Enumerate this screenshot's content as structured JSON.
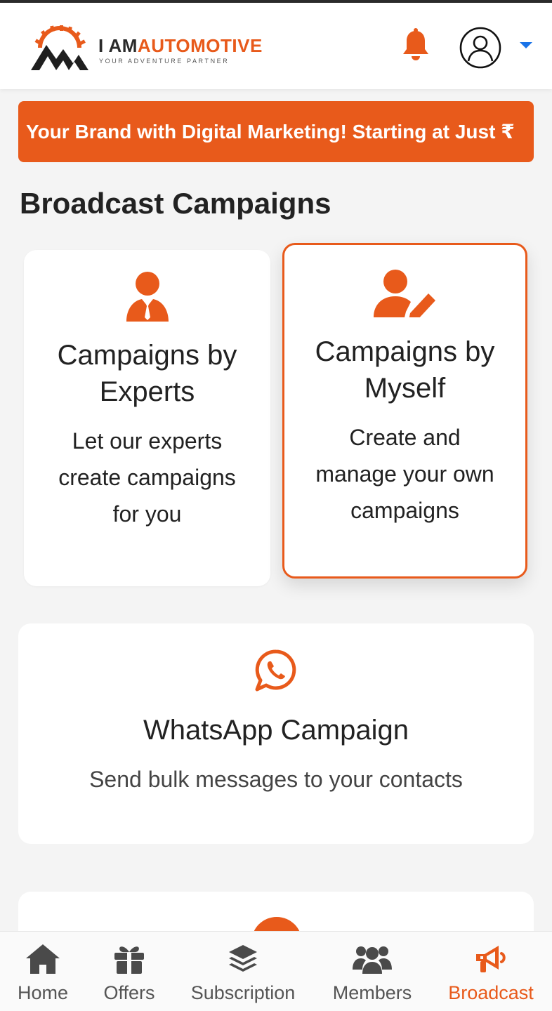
{
  "app": {
    "brand_part1": "I AM",
    "brand_part2": "AUTOMOTIVE",
    "tagline": "YOUR ADVENTURE PARTNER"
  },
  "header": {
    "notification_icon": "bell-icon",
    "profile_icon": "user-circle-icon",
    "menu_icon": "caret-down-icon"
  },
  "promo": {
    "text": "Your Brand with Digital Marketing! Starting at Just ₹"
  },
  "page": {
    "title": "Broadcast Campaigns"
  },
  "cards": {
    "experts": {
      "icon": "user-tie-icon",
      "title_line1": "Campaigns by",
      "title_line2": "Experts",
      "desc_line1": "Let our experts",
      "desc_line2": "create campaigns",
      "desc_line3": "for you"
    },
    "myself": {
      "icon": "user-pen-icon",
      "title_line1": "Campaigns by",
      "title_line2": "Myself",
      "desc_line1": "Create and",
      "desc_line2": "manage your own",
      "desc_line3": "campaigns",
      "selected": true
    },
    "whatsapp": {
      "icon": "whatsapp-icon",
      "title": "WhatsApp Campaign",
      "desc": "Send bulk messages to your contacts"
    }
  },
  "bottom_nav": {
    "items": [
      {
        "label": "Home",
        "icon": "home-icon"
      },
      {
        "label": "Offers",
        "icon": "gift-icon"
      },
      {
        "label": "Subscription",
        "icon": "layers-icon"
      },
      {
        "label": "Members",
        "icon": "users-icon"
      },
      {
        "label": "Broadcast",
        "icon": "megaphone-icon",
        "active": true
      }
    ]
  },
  "colors": {
    "accent": "#e85a1b",
    "text": "#222222",
    "background": "#f4f4f4",
    "nav_inactive": "#555555"
  }
}
